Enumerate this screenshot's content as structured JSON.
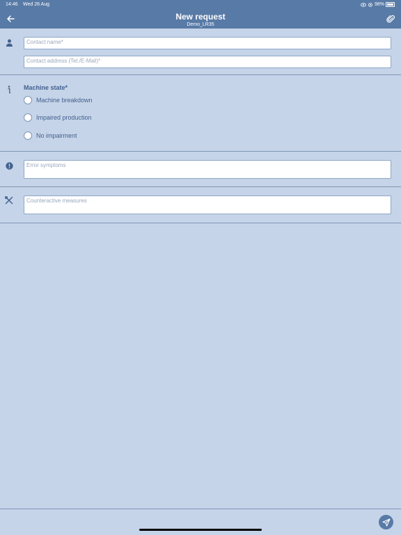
{
  "status_bar": {
    "time": "14:46",
    "date": "Wed 26 Aug",
    "battery": "98%",
    "battery_level": 0.98
  },
  "header": {
    "title": "New request",
    "subtitle": "Demo_LR35",
    "back_icon": "arrow-left-icon",
    "attach_icon": "paperclip-icon",
    "background": "#587aa6"
  },
  "contact": {
    "icon": "person-icon",
    "name_placeholder": "Contact name*",
    "address_placeholder": "Contact address (Tel./E-Mail)*"
  },
  "machine_state": {
    "icon": "info-icon",
    "label": "Machine state*",
    "options": [
      {
        "label": "Machine breakdown",
        "selected": false
      },
      {
        "label": "Impaired production",
        "selected": false
      },
      {
        "label": "No impairment",
        "selected": false
      }
    ]
  },
  "error": {
    "icon": "exclamation-circle-icon",
    "placeholder": "Error symptoms"
  },
  "measures": {
    "icon": "tools-icon",
    "placeholder": "Counteractive measures"
  },
  "footer": {
    "send_icon": "paper-plane-icon"
  },
  "colors": {
    "background": "#c5d4e8",
    "accent": "#587aa6",
    "text": "#43618f"
  }
}
